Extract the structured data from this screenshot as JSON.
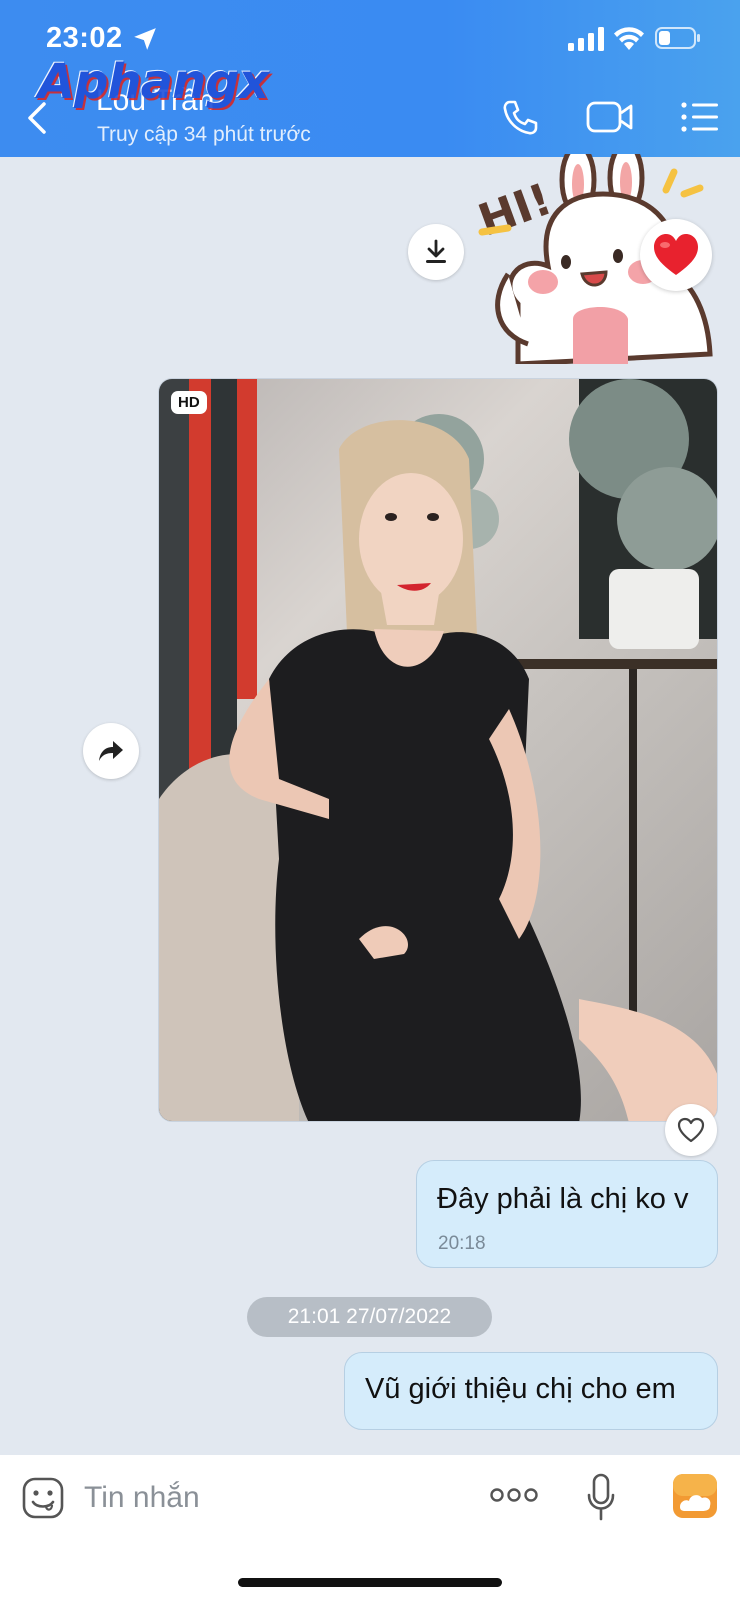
{
  "status_bar": {
    "time": "23:02"
  },
  "header": {
    "watermark": "Aphangx",
    "contact_name": "Lou Trần",
    "contact_status": "Truy cập 34 phút trước"
  },
  "messages": {
    "photo": {
      "badge": "HD"
    },
    "text_1": {
      "text": "Đây phải là chị ko v",
      "time": "20:18"
    },
    "date_separator": "21:01 27/07/2022",
    "text_2": {
      "text": "Vũ giới thiệu chị cho em"
    }
  },
  "input_bar": {
    "placeholder": "Tin nhắn"
  },
  "colors": {
    "header_blue": "#3d8cf0",
    "bubble_blue": "#d5ecfb",
    "chat_background": "#e2e8f0",
    "heart_red": "#e8222e"
  }
}
